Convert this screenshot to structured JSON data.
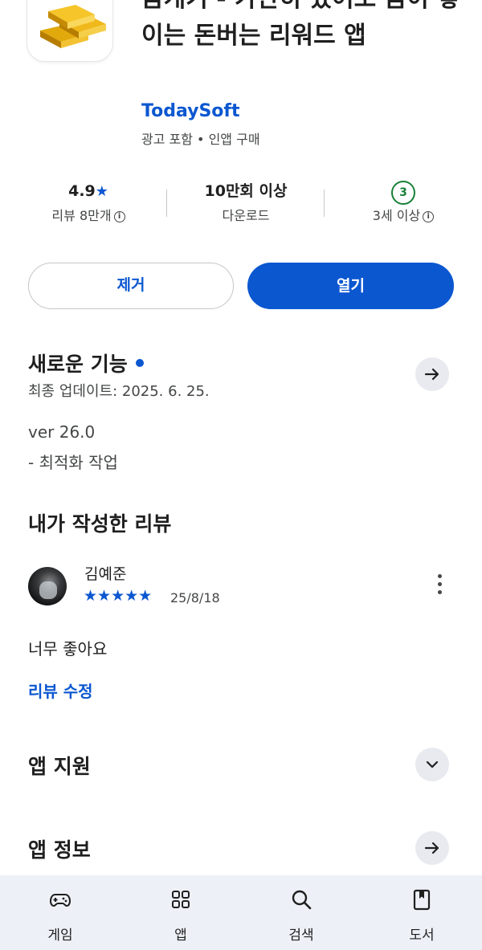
{
  "app": {
    "title": "금캐기 - 가만히 있어도 금이 쌓이는 돈버는 리워드 앱",
    "developer": "TodaySoft",
    "meta": "광고 포함  •  인앱 구매"
  },
  "stats": {
    "rating": "4.9",
    "rating_star": "★",
    "reviews_label": "리뷰 8만개",
    "downloads": "10만회 이상",
    "downloads_label": "다운로드",
    "age_badge": "3",
    "age_label": "3세 이상",
    "info_glyph": "i"
  },
  "actions": {
    "remove_label": "제거",
    "open_label": "열기"
  },
  "whats_new": {
    "title": "새로운 기능",
    "updated": "최종 업데이트: 2025. 6. 25.",
    "version": "ver 26.0",
    "notes": "- 최적화 작업"
  },
  "my_review": {
    "title": "내가 작성한 리뷰",
    "reviewer": "김예준",
    "stars": "★★★★★",
    "rating_value": 5,
    "date": "25/8/18",
    "body": "너무 좋아요",
    "edit_label": "리뷰 수정"
  },
  "app_support": {
    "title": "앱 지원"
  },
  "app_info": {
    "title": "앱 정보"
  },
  "bottom_nav": [
    {
      "label": "게임",
      "icon": "gamepad-icon"
    },
    {
      "label": "앱",
      "icon": "apps-grid-icon"
    },
    {
      "label": "검색",
      "icon": "search-icon"
    },
    {
      "label": "도서",
      "icon": "book-icon"
    }
  ],
  "colors": {
    "accent": "#0b57d0",
    "age_badge": "#188038",
    "nav_background": "#edf1f7"
  }
}
